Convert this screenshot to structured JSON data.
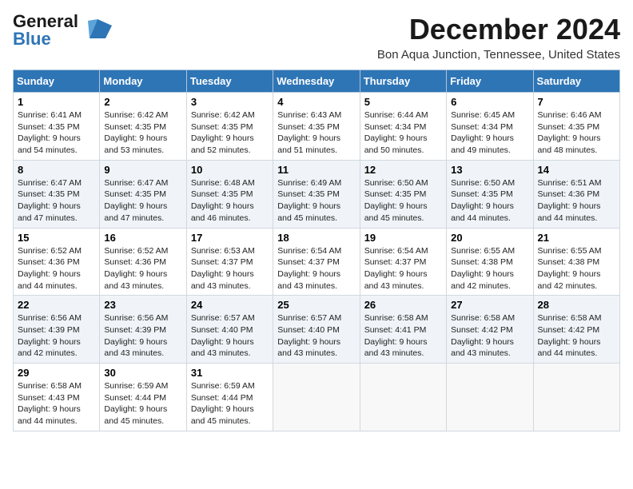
{
  "logo": {
    "line1": "General",
    "line2": "Blue"
  },
  "title": "December 2024",
  "location": "Bon Aqua Junction, Tennessee, United States",
  "weekdays": [
    "Sunday",
    "Monday",
    "Tuesday",
    "Wednesday",
    "Thursday",
    "Friday",
    "Saturday"
  ],
  "weeks": [
    [
      {
        "day": 1,
        "sunrise": "6:41 AM",
        "sunset": "4:35 PM",
        "daylight": "9 hours and 54 minutes."
      },
      {
        "day": 2,
        "sunrise": "6:42 AM",
        "sunset": "4:35 PM",
        "daylight": "9 hours and 53 minutes."
      },
      {
        "day": 3,
        "sunrise": "6:42 AM",
        "sunset": "4:35 PM",
        "daylight": "9 hours and 52 minutes."
      },
      {
        "day": 4,
        "sunrise": "6:43 AM",
        "sunset": "4:35 PM",
        "daylight": "9 hours and 51 minutes."
      },
      {
        "day": 5,
        "sunrise": "6:44 AM",
        "sunset": "4:34 PM",
        "daylight": "9 hours and 50 minutes."
      },
      {
        "day": 6,
        "sunrise": "6:45 AM",
        "sunset": "4:34 PM",
        "daylight": "9 hours and 49 minutes."
      },
      {
        "day": 7,
        "sunrise": "6:46 AM",
        "sunset": "4:35 PM",
        "daylight": "9 hours and 48 minutes."
      }
    ],
    [
      {
        "day": 8,
        "sunrise": "6:47 AM",
        "sunset": "4:35 PM",
        "daylight": "9 hours and 47 minutes."
      },
      {
        "day": 9,
        "sunrise": "6:47 AM",
        "sunset": "4:35 PM",
        "daylight": "9 hours and 47 minutes."
      },
      {
        "day": 10,
        "sunrise": "6:48 AM",
        "sunset": "4:35 PM",
        "daylight": "9 hours and 46 minutes."
      },
      {
        "day": 11,
        "sunrise": "6:49 AM",
        "sunset": "4:35 PM",
        "daylight": "9 hours and 45 minutes."
      },
      {
        "day": 12,
        "sunrise": "6:50 AM",
        "sunset": "4:35 PM",
        "daylight": "9 hours and 45 minutes."
      },
      {
        "day": 13,
        "sunrise": "6:50 AM",
        "sunset": "4:35 PM",
        "daylight": "9 hours and 44 minutes."
      },
      {
        "day": 14,
        "sunrise": "6:51 AM",
        "sunset": "4:36 PM",
        "daylight": "9 hours and 44 minutes."
      }
    ],
    [
      {
        "day": 15,
        "sunrise": "6:52 AM",
        "sunset": "4:36 PM",
        "daylight": "9 hours and 44 minutes."
      },
      {
        "day": 16,
        "sunrise": "6:52 AM",
        "sunset": "4:36 PM",
        "daylight": "9 hours and 43 minutes."
      },
      {
        "day": 17,
        "sunrise": "6:53 AM",
        "sunset": "4:37 PM",
        "daylight": "9 hours and 43 minutes."
      },
      {
        "day": 18,
        "sunrise": "6:54 AM",
        "sunset": "4:37 PM",
        "daylight": "9 hours and 43 minutes."
      },
      {
        "day": 19,
        "sunrise": "6:54 AM",
        "sunset": "4:37 PM",
        "daylight": "9 hours and 43 minutes."
      },
      {
        "day": 20,
        "sunrise": "6:55 AM",
        "sunset": "4:38 PM",
        "daylight": "9 hours and 42 minutes."
      },
      {
        "day": 21,
        "sunrise": "6:55 AM",
        "sunset": "4:38 PM",
        "daylight": "9 hours and 42 minutes."
      }
    ],
    [
      {
        "day": 22,
        "sunrise": "6:56 AM",
        "sunset": "4:39 PM",
        "daylight": "9 hours and 42 minutes."
      },
      {
        "day": 23,
        "sunrise": "6:56 AM",
        "sunset": "4:39 PM",
        "daylight": "9 hours and 43 minutes."
      },
      {
        "day": 24,
        "sunrise": "6:57 AM",
        "sunset": "4:40 PM",
        "daylight": "9 hours and 43 minutes."
      },
      {
        "day": 25,
        "sunrise": "6:57 AM",
        "sunset": "4:40 PM",
        "daylight": "9 hours and 43 minutes."
      },
      {
        "day": 26,
        "sunrise": "6:58 AM",
        "sunset": "4:41 PM",
        "daylight": "9 hours and 43 minutes."
      },
      {
        "day": 27,
        "sunrise": "6:58 AM",
        "sunset": "4:42 PM",
        "daylight": "9 hours and 43 minutes."
      },
      {
        "day": 28,
        "sunrise": "6:58 AM",
        "sunset": "4:42 PM",
        "daylight": "9 hours and 44 minutes."
      }
    ],
    [
      {
        "day": 29,
        "sunrise": "6:58 AM",
        "sunset": "4:43 PM",
        "daylight": "9 hours and 44 minutes."
      },
      {
        "day": 30,
        "sunrise": "6:59 AM",
        "sunset": "4:44 PM",
        "daylight": "9 hours and 45 minutes."
      },
      {
        "day": 31,
        "sunrise": "6:59 AM",
        "sunset": "4:44 PM",
        "daylight": "9 hours and 45 minutes."
      },
      null,
      null,
      null,
      null
    ]
  ]
}
